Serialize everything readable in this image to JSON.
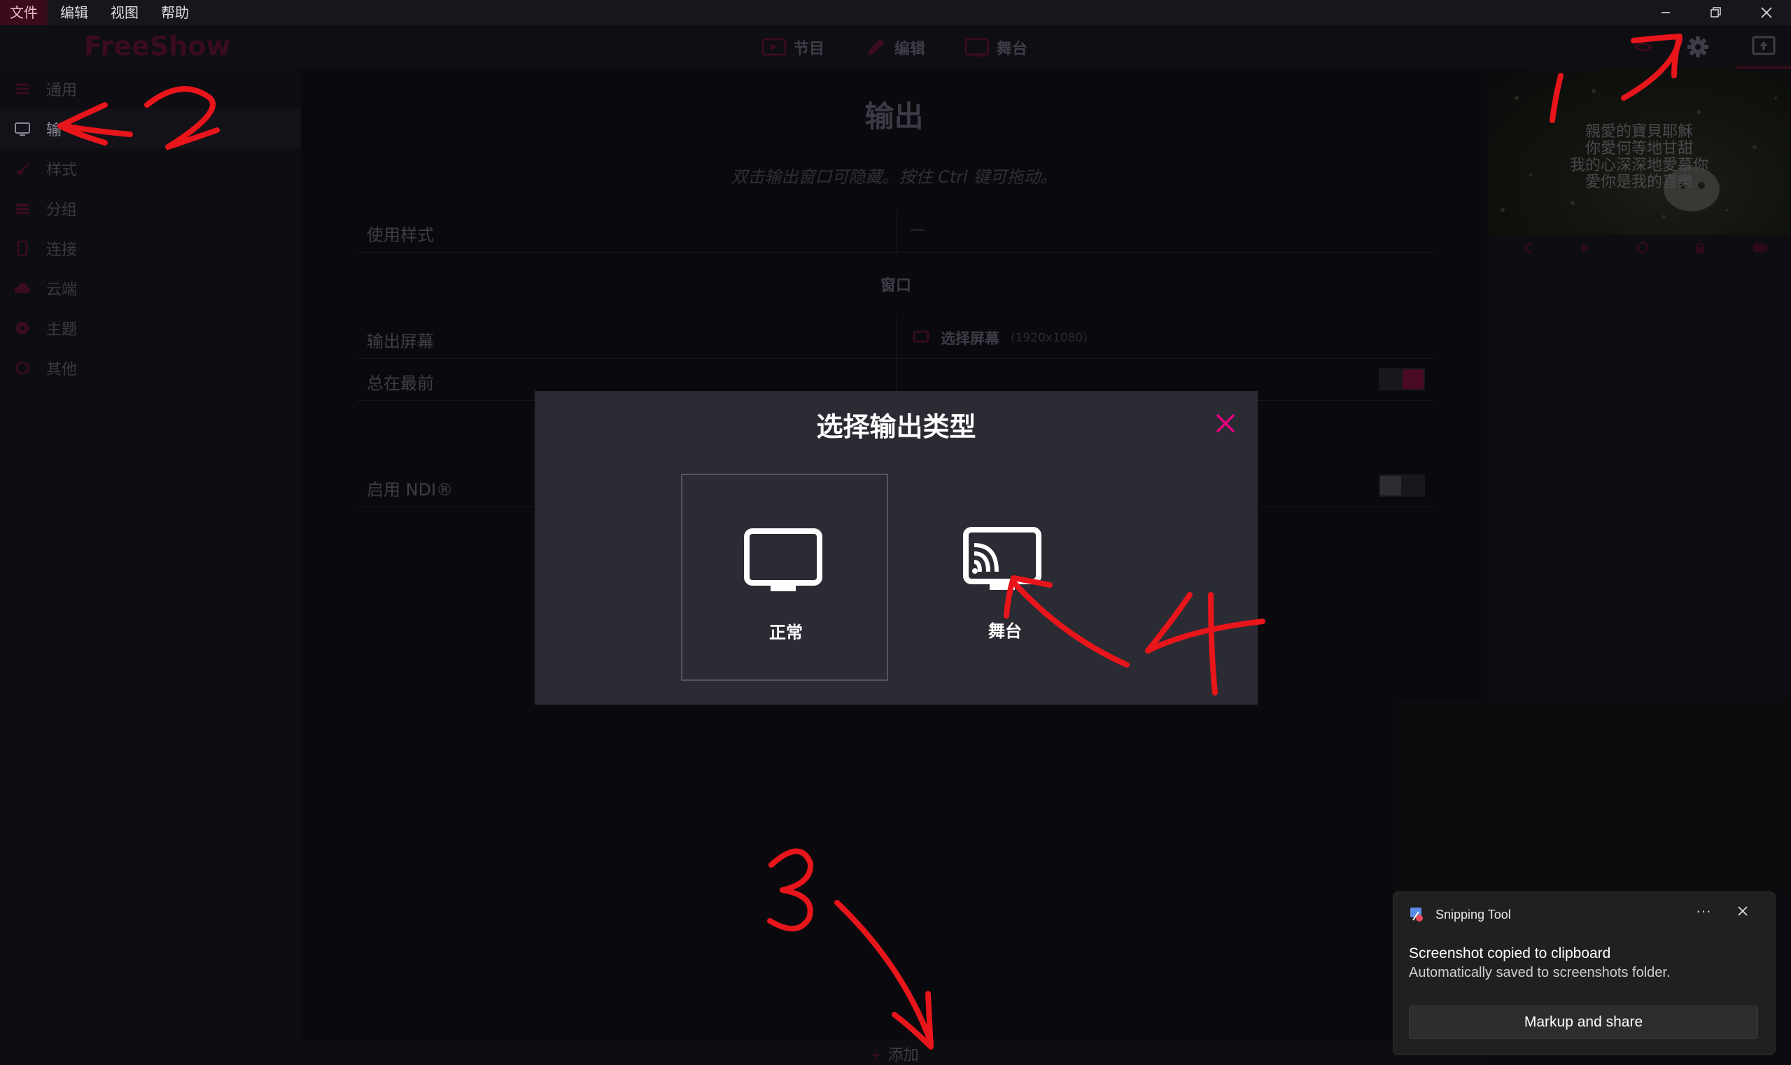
{
  "menubar": {
    "items": [
      "文件",
      "编辑",
      "视图",
      "帮助"
    ],
    "active_index": 0
  },
  "topnav": {
    "logo": "FreeShow",
    "tabs": [
      {
        "label": "节目",
        "icon": "screen-play-icon"
      },
      {
        "label": "编辑",
        "icon": "pencil-icon"
      },
      {
        "label": "舞台",
        "icon": "stage-icon"
      }
    ],
    "right_icons": [
      "settings-gear-icon",
      "output-toggle-icon"
    ]
  },
  "sidebar": {
    "items": [
      {
        "label": "通用",
        "icon": "sliders-icon"
      },
      {
        "label": "输",
        "icon": "monitor-icon"
      },
      {
        "label": "样式",
        "icon": "brush-icon"
      },
      {
        "label": "分组",
        "icon": "groups-icon"
      },
      {
        "label": "连接",
        "icon": "phone-icon"
      },
      {
        "label": "云端",
        "icon": "cloud-icon"
      },
      {
        "label": "主题",
        "icon": "palette-icon"
      },
      {
        "label": "其他",
        "icon": "circle-icon"
      }
    ],
    "active_index": 1
  },
  "main": {
    "title": "输出",
    "hint": "双击输出窗口可隐藏。按住 Ctrl 键可拖动。",
    "style_row": {
      "label": "使用样式",
      "value": "—"
    },
    "window_section": "窗口",
    "screen_row": {
      "label": "输出屏幕",
      "value": "选择屏幕",
      "resolution": "(1920x1080)"
    },
    "ontop_row": {
      "label": "总在最前",
      "enabled": true
    },
    "ndi_row": {
      "label": "启用 NDI®",
      "enabled": false
    },
    "add_label": "添加"
  },
  "preview": {
    "lyrics": [
      "親愛的寶貝耶穌",
      "你愛何等地甘甜",
      "我的心深深地愛慕你",
      "愛你是我的喜樂"
    ]
  },
  "modal": {
    "title": "选择输出类型",
    "options": [
      {
        "label": "正常",
        "icon": "monitor-icon",
        "selected": true
      },
      {
        "label": "舞台",
        "icon": "cast-screen-icon",
        "selected": false
      }
    ]
  },
  "toast": {
    "app_name": "Snipping Tool",
    "line1": "Screenshot copied to clipboard",
    "line2": "Automatically saved to screenshots folder.",
    "button": "Markup and share",
    "more": "···"
  },
  "annotations": [
    "1",
    "2",
    "3",
    "4"
  ],
  "colors": {
    "accent": "#e6007e",
    "annotation_red": "#e8151b",
    "modal_bg": "#2b2b33",
    "app_bg": "#0b0b10"
  }
}
